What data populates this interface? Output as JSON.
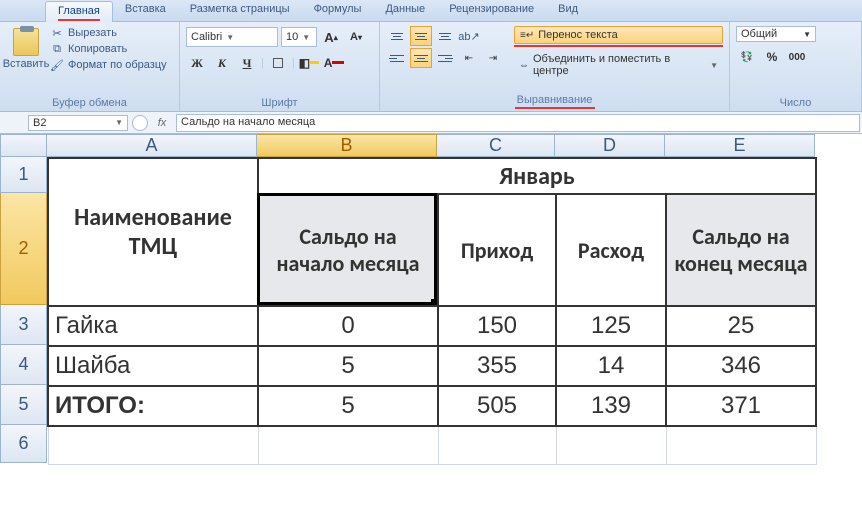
{
  "tabs": {
    "home": "Главная",
    "insert": "Вставка",
    "layout": "Разметка страницы",
    "formulas": "Формулы",
    "data": "Данные",
    "review": "Рецензирование",
    "view": "Вид"
  },
  "clipboard": {
    "paste": "Вставить",
    "cut": "Вырезать",
    "copy": "Копировать",
    "format_painter": "Формат по образцу",
    "group_label": "Буфер обмена"
  },
  "font": {
    "family": "Calibri",
    "size": "10",
    "bold": "Ж",
    "italic": "К",
    "underline": "Ч",
    "group_label": "Шрифт"
  },
  "align": {
    "wrap_text": "Перенос текста",
    "merge_center": "Объединить и поместить в центре",
    "group_label": "Выравнивание"
  },
  "number": {
    "format": "Общий",
    "group_label": "Число"
  },
  "formula_bar": {
    "cell_ref": "B2",
    "fx": "fx",
    "content": "Сальдо на начало месяца"
  },
  "columns": {
    "A": "A",
    "B": "B",
    "C": "C",
    "D": "D",
    "E": "E"
  },
  "rows": {
    "r1": "1",
    "r2": "2",
    "r3": "3",
    "r4": "4",
    "r5": "5",
    "r6": "6"
  },
  "table": {
    "name_header": "Наименование ТМЦ",
    "month": "Январь",
    "col_b": "Сальдо на начало месяца",
    "col_c": "Приход",
    "col_d": "Расход",
    "col_e": "Сальдо на конец месяца",
    "rows": [
      {
        "name": "Гайка",
        "b": "0",
        "c": "150",
        "d": "125",
        "e": "25"
      },
      {
        "name": "Шайба",
        "b": "5",
        "c": "355",
        "d": "14",
        "e": "346"
      },
      {
        "name": "ИТОГО:",
        "b": "5",
        "c": "505",
        "d": "139",
        "e": "371"
      }
    ]
  },
  "chart_data": {
    "type": "table",
    "title": "Январь",
    "columns": [
      "Наименование ТМЦ",
      "Сальдо на начало месяца",
      "Приход",
      "Расход",
      "Сальдо на конец месяца"
    ],
    "rows": [
      [
        "Гайка",
        0,
        150,
        125,
        25
      ],
      [
        "Шайба",
        5,
        355,
        14,
        346
      ],
      [
        "ИТОГО:",
        5,
        505,
        139,
        371
      ]
    ]
  }
}
